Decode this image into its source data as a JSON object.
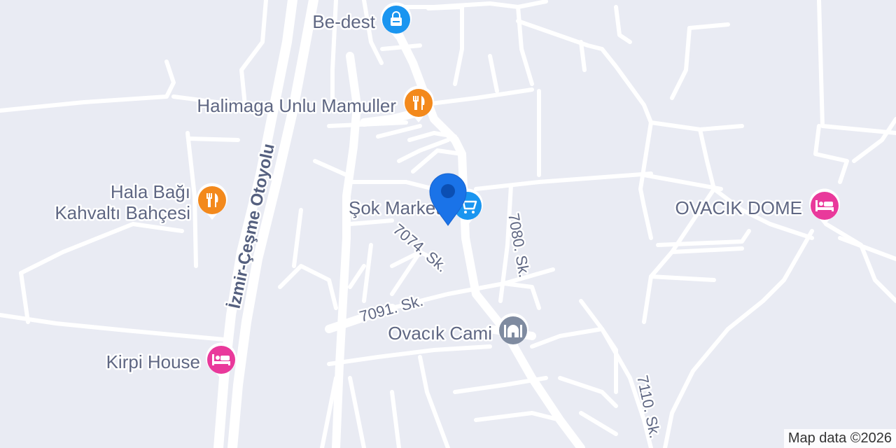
{
  "map": {
    "highway_label": "İzmir-Çeşme Otoyolu",
    "pois": [
      {
        "id": "be-dest",
        "name": "Be-dest",
        "category": "shopping",
        "icon": "shopping-bag-icon",
        "color": "#1a95f0"
      },
      {
        "id": "halimaga",
        "name": "Halimaga Unlu Mamuller",
        "category": "restaurant",
        "icon": "fork-knife-icon",
        "color": "#f3891c"
      },
      {
        "id": "hala-bagi",
        "name_lines": [
          "Hala Bağı",
          "Kahvaltı Bahçesi"
        ],
        "category": "restaurant",
        "icon": "fork-knife-icon",
        "color": "#f3891c"
      },
      {
        "id": "sok-market",
        "name": "Şok Market",
        "category": "shopping",
        "icon": "shopping-cart-icon",
        "color": "#1a95f0"
      },
      {
        "id": "ovacik-dome",
        "name": "OVACIK DOME",
        "category": "lodging",
        "icon": "bed-icon",
        "color": "#e9399b"
      },
      {
        "id": "ovacik-cami",
        "name": "Ovacık Cami",
        "category": "place-of-worship",
        "icon": "mosque-icon",
        "color": "#7f8ba0"
      },
      {
        "id": "kirpi-house",
        "name": "Kirpi House",
        "category": "lodging",
        "icon": "bed-icon",
        "color": "#e9399b"
      }
    ],
    "streets": [
      "7074. Sk.",
      "7080. Sk.",
      "7091. Sk.",
      "7110. Sk."
    ],
    "location_marker": {
      "color": "#1a73e8",
      "inner": "#0b4fb3"
    },
    "attribution": "Map data ©2026"
  }
}
